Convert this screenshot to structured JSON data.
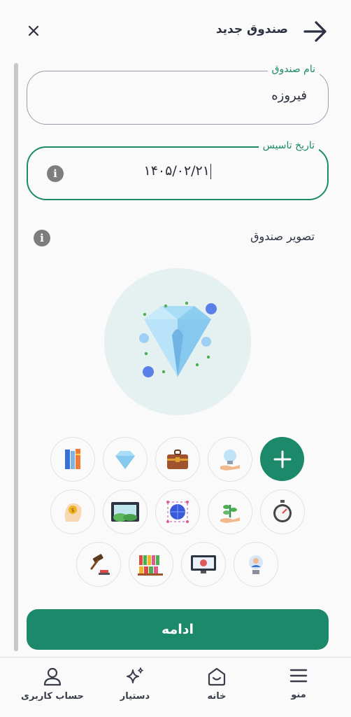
{
  "header": {
    "title": "صندوق جدید"
  },
  "form": {
    "name_label": "نام صندوق",
    "name_value": "فیروزه",
    "date_label": "تاریخ تاسیس",
    "date_value": "۱۴۰۵/۰۲/۲۱",
    "image_label": "تصویر صندوق"
  },
  "icon_options": [
    "add-icon",
    "lightbulb-icon",
    "treasure-chest-icon",
    "diamond-icon",
    "books-icon",
    "stopwatch-icon",
    "plant-hand-icon",
    "globe-icon",
    "landscape-frame-icon",
    "coin-head-icon",
    "avatar-badge-icon",
    "monitor-chart-icon",
    "bookshelf-icon",
    "gavel-icon"
  ],
  "selected_icon": "diamond-icon",
  "continue_label": "ادامه",
  "nav": {
    "menu": "منو",
    "home": "خانه",
    "assistant": "دستیار",
    "account": "حساب کاربری"
  },
  "colors": {
    "accent": "#1c8a6a",
    "preview_bg": "#e5f1f0",
    "diamond": "#9dd5f5"
  }
}
